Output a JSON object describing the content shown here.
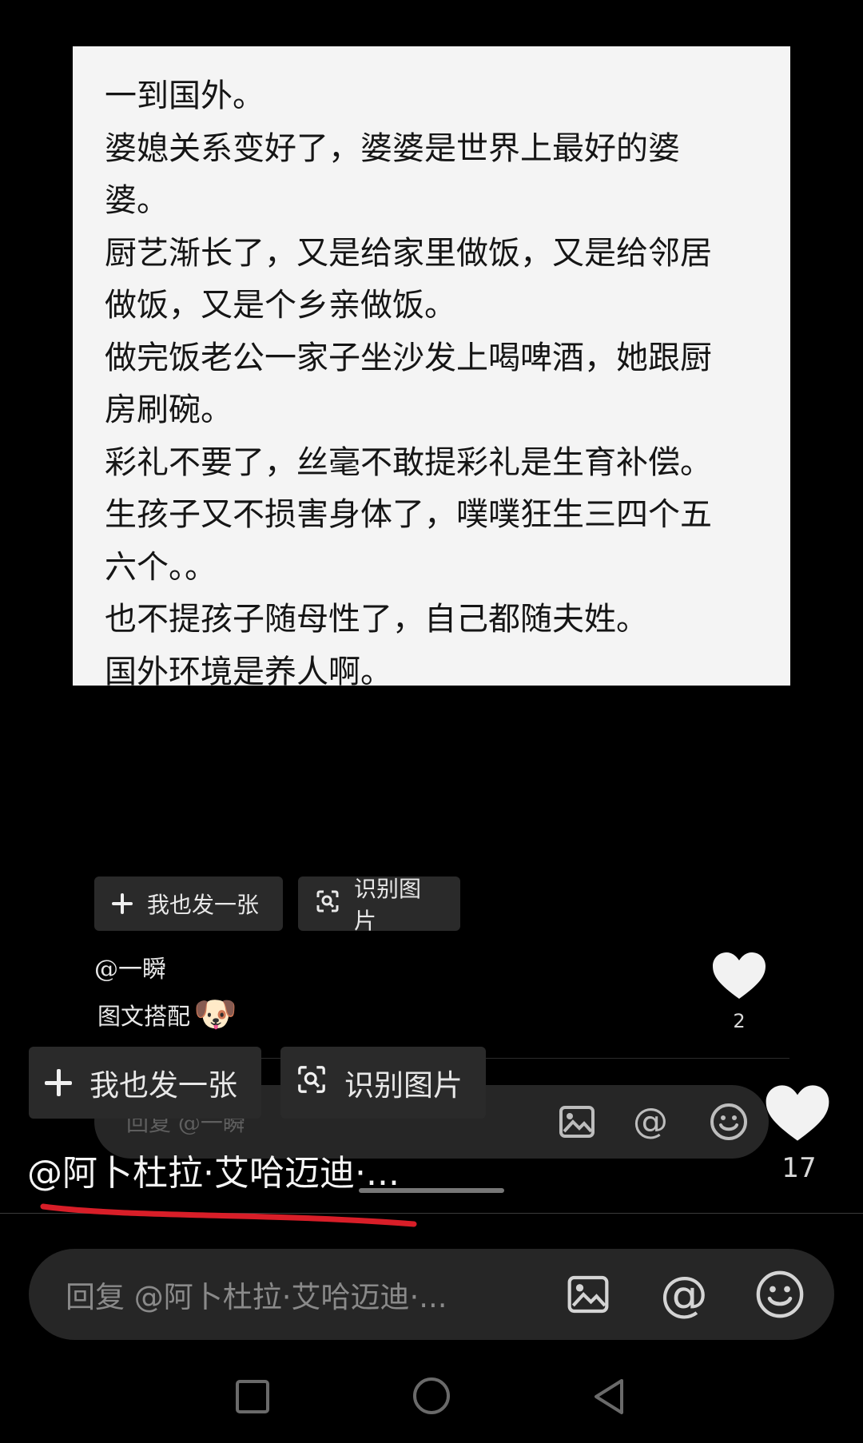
{
  "post_image": {
    "lines": [
      "一到国外。",
      "婆媳关系变好了，婆婆是世界上最好的婆",
      "婆。",
      "厨艺渐长了，又是给家里做饭，又是给邻居",
      "做饭，又是个乡亲做饭。",
      "做完饭老公一家子坐沙发上喝啤酒，她跟厨",
      "房刷碗。",
      "彩礼不要了，丝毫不敢提彩礼是生育补偿。",
      "生孩子又不损害身体了，噗噗狂生三四个五",
      "六个。。",
      "也不提孩子随母性了，自己都随夫姓。",
      "国外环境是养人啊。"
    ]
  },
  "inner_actions": {
    "post_same": "我也发一张",
    "recognize": "识别图片"
  },
  "inner_comment": {
    "mention": "@一瞬",
    "text": "图文搭配",
    "emoji": "🐶",
    "like_count": "2"
  },
  "inner_reply_bar": {
    "placeholder": "回复 @一瞬"
  },
  "outer_actions": {
    "post_same": "我也发一张",
    "recognize": "识别图片"
  },
  "outer_comment": {
    "mention": "@阿卜杜拉·艾哈迈迪·...",
    "like_count": "17"
  },
  "reply_bar": {
    "placeholder": "回复 @阿卜杜拉·艾哈迈迪·..."
  },
  "colors": {
    "background": "#000000",
    "chip_bg": "#2a2a2a",
    "reply_bar_bg": "#262626",
    "underline": "#d81e28",
    "heart": "#f2f2f2"
  },
  "nav": {
    "icons": [
      "recents-icon",
      "home-icon",
      "back-icon"
    ]
  }
}
